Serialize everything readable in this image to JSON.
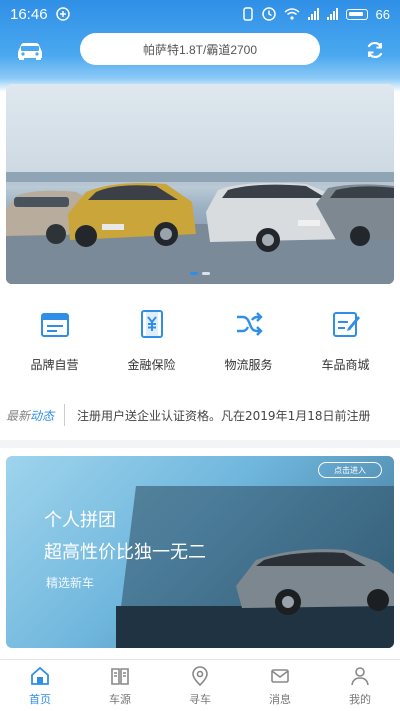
{
  "status_bar": {
    "time": "16:46",
    "battery_level": "66"
  },
  "header": {
    "search_text": "帕萨特1.8T/霸道2700"
  },
  "banner": {
    "slide_count": 2,
    "active_slide": 1
  },
  "shortcuts": [
    {
      "label": "品牌自营",
      "icon": "store-card-icon"
    },
    {
      "label": "金融保险",
      "icon": "finance-icon"
    },
    {
      "label": "物流服务",
      "icon": "logistics-shuffle-icon"
    },
    {
      "label": "车品商城",
      "icon": "mall-edit-icon"
    }
  ],
  "news": {
    "tag_prefix": "最新",
    "tag_suffix": "动态",
    "text": "注册用户送企业认证资格。凡在2019年1月18日前注册"
  },
  "promo": {
    "title": "个人拼团",
    "subtitle": "超高性价比独一无二",
    "note": "精选新车",
    "button": "点击进入"
  },
  "tabs": [
    {
      "label": "首页",
      "active": true
    },
    {
      "label": "车源",
      "active": false
    },
    {
      "label": "寻车",
      "active": false
    },
    {
      "label": "消息",
      "active": false
    },
    {
      "label": "我的",
      "active": false
    }
  ],
  "colors": {
    "accent": "#2f8fe6",
    "text": "#333333"
  }
}
